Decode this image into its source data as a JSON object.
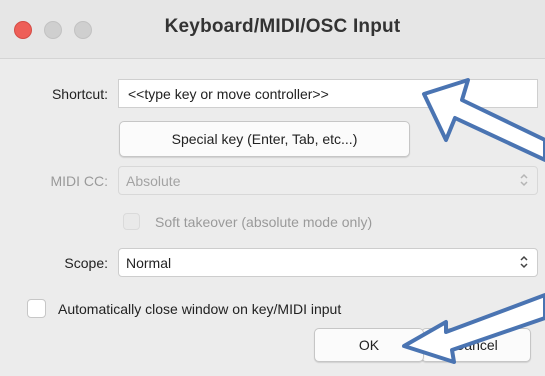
{
  "window": {
    "title": "Keyboard/MIDI/OSC Input"
  },
  "shortcut": {
    "label": "Shortcut:",
    "value": "<<type key or move controller>>"
  },
  "special_key_button": "Special key (Enter, Tab, etc...)",
  "midi_cc": {
    "label": "MIDI CC:",
    "value": "Absolute"
  },
  "soft_takeover": {
    "label": "Soft takeover (absolute mode only)"
  },
  "scope": {
    "label": "Scope:",
    "value": "Normal"
  },
  "auto_close": {
    "label": "Automatically close window on key/MIDI input"
  },
  "buttons": {
    "ok": "OK",
    "cancel": "Cancel"
  },
  "colors": {
    "annotation_arrow": "#4a74b2",
    "close_light": "#ee5f58"
  }
}
